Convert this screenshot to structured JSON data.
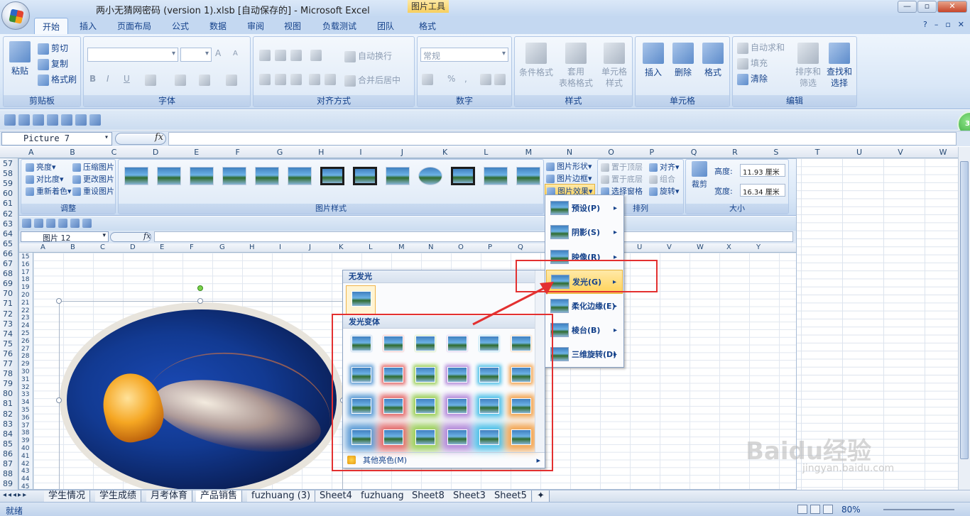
{
  "title_bar": {
    "document_title": "两小无猜网密码 (version 1).xlsb [自动保存的] - Microsoft Excel",
    "context_tab_group": "图片工具"
  },
  "tabs": [
    "开始",
    "插入",
    "页面布局",
    "公式",
    "数据",
    "审阅",
    "视图",
    "负载测试",
    "团队",
    "格式"
  ],
  "active_tab": "开始",
  "ribbon": {
    "clipboard": {
      "paste": "粘贴",
      "cut": "剪切",
      "copy": "复制",
      "format_painter": "格式刷",
      "label": "剪贴板"
    },
    "font": {
      "label": "字体",
      "bold": "B",
      "italic": "I",
      "underline": "U",
      "grow": "A",
      "shrink": "A"
    },
    "alignment": {
      "wrap": "自动换行",
      "merge": "合并后居中",
      "label": "对齐方式"
    },
    "number": {
      "format": "常规",
      "percent": "%",
      "comma": ",",
      "label": "数字"
    },
    "styles": {
      "conditional": "条件格式",
      "table_1": "套用",
      "table_2": "表格格式",
      "cell_1": "单元格",
      "cell_2": "样式",
      "label": "样式"
    },
    "cells": {
      "insert": "插入",
      "delete": "删除",
      "format": "格式",
      "label": "单元格"
    },
    "editing": {
      "autosum": "自动求和",
      "fill": "填充",
      "clear": "清除",
      "sort_1": "排序和",
      "sort_2": "筛选",
      "find_1": "查找和",
      "find_2": "选择",
      "label": "编辑"
    }
  },
  "formula_bar": {
    "name_box": "Picture 7",
    "fx": "fx",
    "formula": ""
  },
  "outer_columns": [
    "A",
    "B",
    "C",
    "D",
    "E",
    "F",
    "G",
    "H",
    "I",
    "J",
    "K",
    "L",
    "M",
    "N",
    "O",
    "P",
    "Q",
    "R",
    "S",
    "T",
    "U",
    "V",
    "W",
    "X",
    "Y"
  ],
  "outer_rows": [
    "57",
    "58",
    "59",
    "60",
    "61",
    "62",
    "63",
    "64",
    "65",
    "66",
    "67",
    "68",
    "69",
    "70",
    "71",
    "72",
    "73",
    "74",
    "75",
    "76",
    "77",
    "78",
    "79",
    "80",
    "81",
    "82",
    "83",
    "84",
    "85",
    "86",
    "87",
    "88",
    "89"
  ],
  "inner": {
    "adjust": {
      "brightness": "亮度",
      "contrast": "对比度",
      "recolor": "重新着色",
      "compress": "压缩图片",
      "change": "更改图片",
      "reset": "重设图片",
      "label": "调整"
    },
    "picture_styles_label": "图片样式",
    "shape": "图片形状",
    "border": "图片边框",
    "effects": "图片效果",
    "arrange": {
      "front": "置于顶层",
      "back": "置于底层",
      "pane": "选择窗格",
      "align": "对齐",
      "group": "组合",
      "rotate": "旋转",
      "label": "排列"
    },
    "size": {
      "crop": "裁剪",
      "height_label": "高度:",
      "height": "11.93 厘米",
      "width_label": "宽度:",
      "width": "16.34 厘米",
      "label": "大小"
    },
    "name_box": "图片 12",
    "fx": "fx",
    "columns": [
      "A",
      "B",
      "C",
      "D",
      "E",
      "F",
      "G",
      "H",
      "I",
      "J",
      "K",
      "L",
      "M",
      "N",
      "O",
      "P",
      "Q",
      "R",
      "S",
      "T",
      "U",
      "V",
      "W",
      "X",
      "Y"
    ],
    "rows": [
      "15",
      "16",
      "17",
      "18",
      "19",
      "20",
      "21",
      "22",
      "23",
      "24",
      "25",
      "26",
      "27",
      "28",
      "29",
      "30",
      "31",
      "32",
      "33",
      "34",
      "35",
      "36",
      "37",
      "38",
      "39",
      "40",
      "41",
      "42",
      "43",
      "44",
      "45"
    ]
  },
  "glow_gallery": {
    "no_glow": "无发光",
    "variations": "发光变体",
    "more_colors": "其他亮色(M)",
    "glow_colors": [
      "#5b9bd5",
      "#e36c6c",
      "#9bcf5a",
      "#b38ad9",
      "#4fc0e8",
      "#f2a552"
    ]
  },
  "effects_menu": [
    {
      "label": "预设(P)",
      "hot": false
    },
    {
      "label": "阴影(S)",
      "hot": false
    },
    {
      "label": "映像(R)",
      "hot": false
    },
    {
      "label": "发光(G)",
      "hot": true
    },
    {
      "label": "柔化边缘(E)",
      "hot": false
    },
    {
      "label": "棱台(B)",
      "hot": false
    },
    {
      "label": "三维旋转(D)",
      "hot": false
    }
  ],
  "sheet_tabs": [
    "学生情况",
    "学生成绩",
    "月考体育",
    "产品销售",
    "fuzhuang (3)",
    "Sheet4",
    "fuzhuang",
    "Sheet8",
    "Sheet3",
    "Sheet5"
  ],
  "active_sheet_tab": "产品销售",
  "status": {
    "ready": "就绪",
    "zoom": "80%"
  },
  "badge": "36",
  "watermark": {
    "main": "Baidu经验",
    "sub": "jingyan.baidu.com"
  },
  "accent_colors": {
    "annotation_red": "#e33030",
    "hover_gold": "#ffd257",
    "ribbon_blue": "#15428b"
  }
}
